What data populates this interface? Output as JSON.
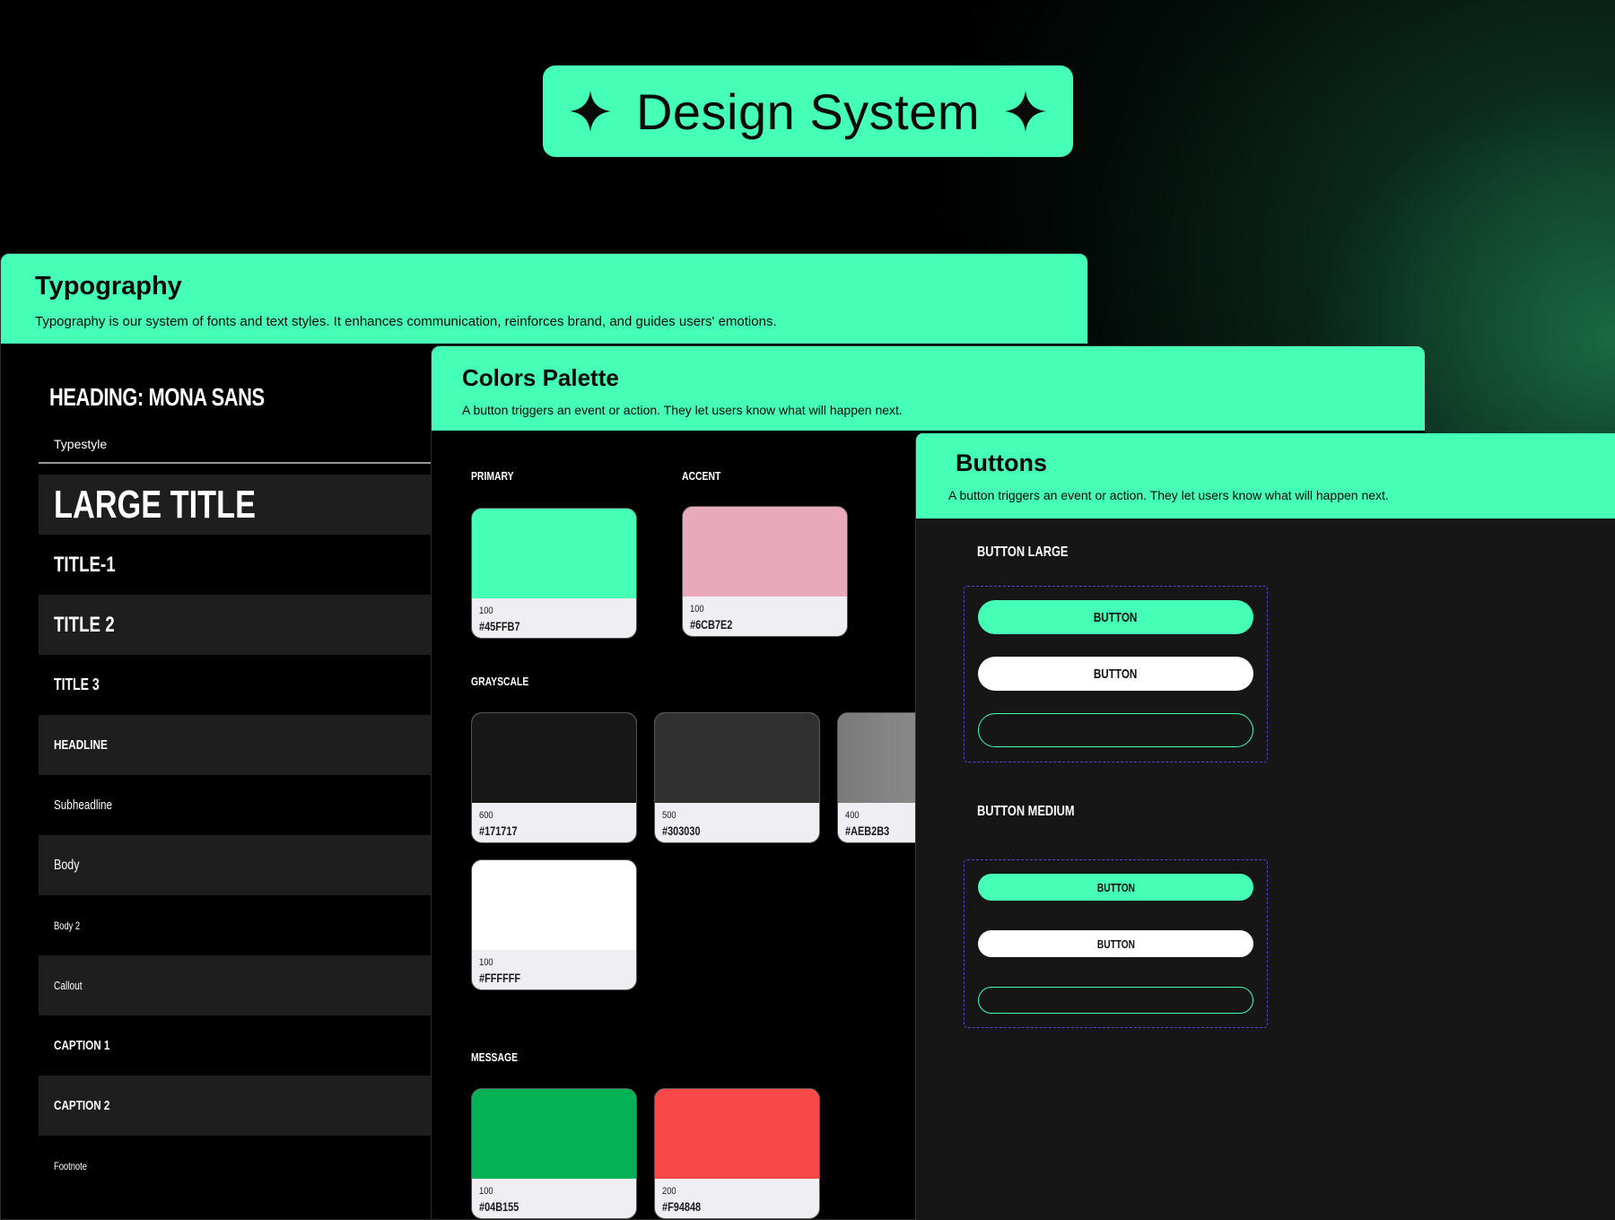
{
  "hero": {
    "title": "Design System",
    "left_icon": "sparkle-icon",
    "right_icon": "sparkle-icon"
  },
  "colors_accent": "#45FFB7",
  "typography": {
    "title": "Typography",
    "description": "Typography is our system of fonts and text styles. It enhances communication, reinforces brand, and guides users' emotions.",
    "heading": "HEADING: MONA SANS",
    "typestyle_label": "Typestyle",
    "styles": [
      "LARGE TITLE",
      "TITLE-1",
      "TITLE 2",
      "TITLE 3",
      "HEADLINE",
      "Subheadline",
      "Body",
      "Body 2",
      "Callout",
      "CAPTION 1",
      "CAPTION 2",
      "Footnote"
    ]
  },
  "colors_palette": {
    "title": "Colors Palette",
    "description": "A button triggers an event or action. They let users know what will happen next.",
    "primary_label": "PRIMARY",
    "accent_label": "ACCENT",
    "grayscale_label": "GRAYSCALE",
    "message_label": "MESSAGE",
    "primary": [
      {
        "level": "100",
        "hex": "#45FFB7",
        "color": "#45FFB7"
      }
    ],
    "accent": [
      {
        "level": "100",
        "hex": "#6CB7E2",
        "color": "#E8AABB"
      }
    ],
    "grayscale": [
      {
        "level": "600",
        "hex": "#171717",
        "color": "#171717"
      },
      {
        "level": "500",
        "hex": "#303030",
        "color": "#303030"
      },
      {
        "level": "400",
        "hex": "#AEB2B3",
        "color": "#7a7a7a"
      },
      {
        "level": "100",
        "hex": "#FFFFFF",
        "color": "#FFFFFF"
      }
    ],
    "message": [
      {
        "level": "100",
        "hex": "#04B155",
        "color": "#04B155"
      },
      {
        "level": "200",
        "hex": "#F94848",
        "color": "#F94848"
      }
    ]
  },
  "buttons": {
    "title": "Buttons",
    "description": "A button triggers an event or action. They let users know what will happen next.",
    "large_label": "BUTTON LARGE",
    "medium_label": "BUTTON MEDIUM",
    "button_text": "BUTTON"
  }
}
